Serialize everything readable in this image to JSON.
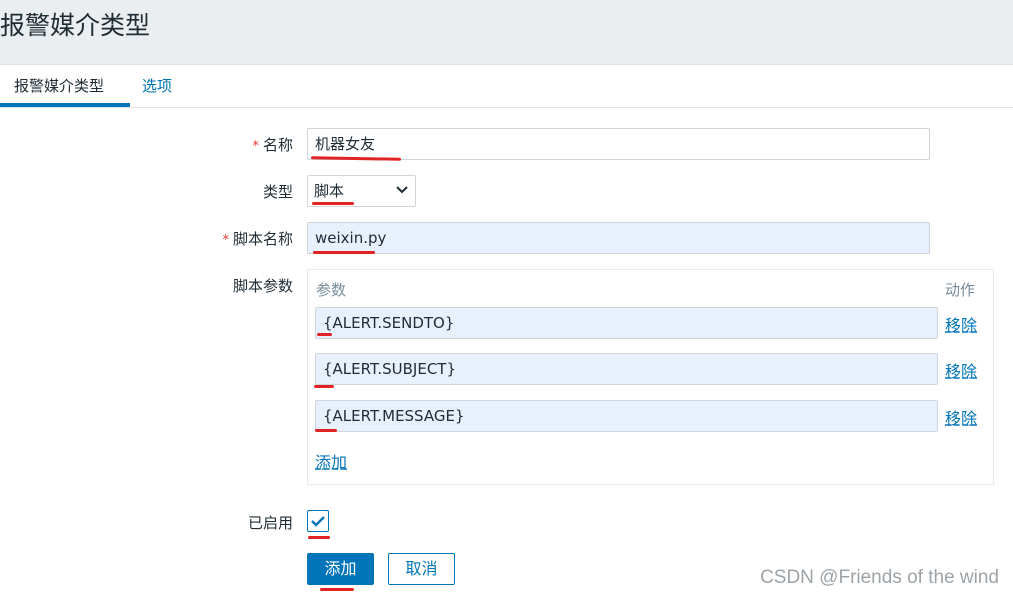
{
  "page": {
    "title": "报警媒介类型"
  },
  "tabs": [
    {
      "label": "报警媒介类型"
    },
    {
      "label": "选项"
    }
  ],
  "form": {
    "name": {
      "label": "名称",
      "required_mark": "*",
      "value": "机器女友"
    },
    "type": {
      "label": "类型",
      "value": "脚本"
    },
    "script_name": {
      "label": "脚本名称",
      "required_mark": "*",
      "value": "weixin.py"
    },
    "script_params": {
      "label": "脚本参数",
      "col_param": "参数",
      "col_action": "动作",
      "params": [
        {
          "value": "{ALERT.SENDTO}",
          "remove_label": "移除"
        },
        {
          "value": "{ALERT.SUBJECT}",
          "remove_label": "移除"
        },
        {
          "value": "{ALERT.MESSAGE}",
          "remove_label": "移除"
        }
      ],
      "add_label": "添加"
    },
    "enabled": {
      "label": "已启用",
      "checked": true
    }
  },
  "buttons": {
    "add_label": "添加",
    "cancel_label": "取消"
  },
  "watermark": "CSDN @Friends of the wind",
  "colors": {
    "accent": "#0275b8",
    "required": "#e33734",
    "annotation": "#e02424"
  }
}
